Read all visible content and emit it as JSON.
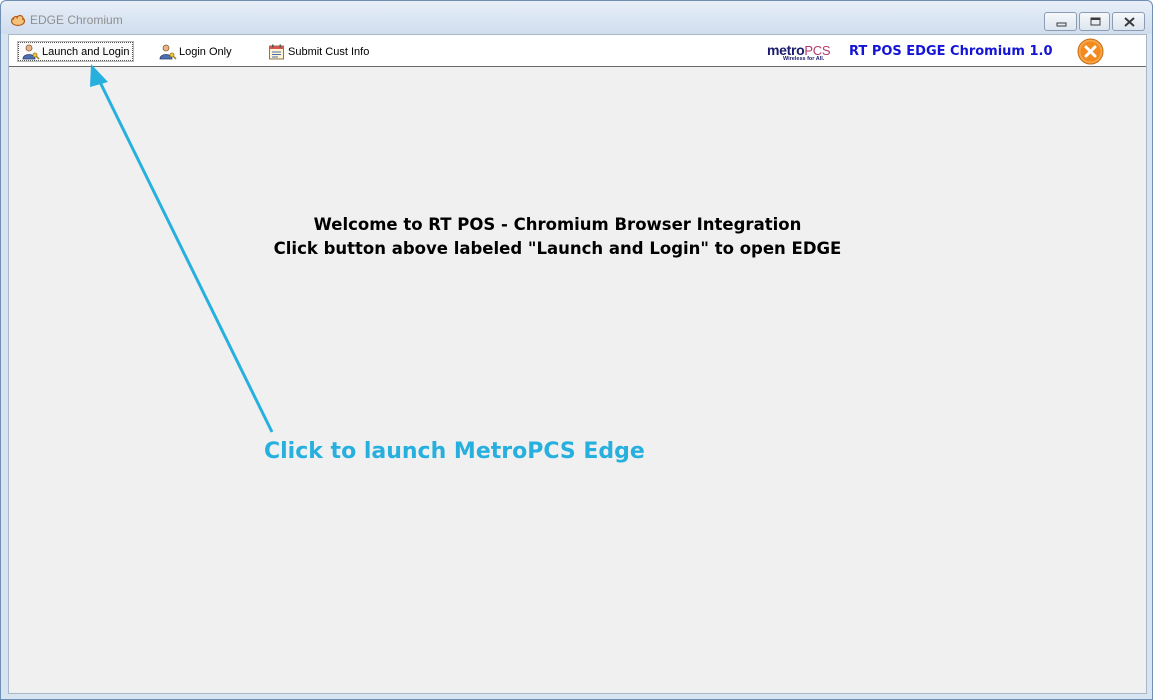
{
  "window": {
    "title": "EDGE Chromium",
    "icon": "cloud-app-icon",
    "controls": [
      "minimize-icon",
      "restore-icon",
      "close-icon"
    ]
  },
  "toolbar": {
    "buttons": [
      {
        "label": "Launch and Login",
        "icon": "user-key-icon",
        "focused": true
      },
      {
        "label": "Login Only",
        "icon": "user-key-icon"
      },
      {
        "label": "Submit Cust Info",
        "icon": "calendar-form-icon"
      }
    ],
    "logo": {
      "brand": "metroPCS",
      "tagline": "Wireless for All."
    },
    "app_version": "RT POS EDGE Chromium 1.0",
    "exit_icon": "orange-close-icon"
  },
  "main": {
    "welcome_line1": "Welcome to RT POS - Chromium Browser Integration",
    "welcome_line2": "Click button above labeled \"Launch and Login\" to open EDGE"
  },
  "annotation": {
    "text": "Click to launch MetroPCS Edge",
    "color": "#27b0de"
  },
  "colors": {
    "version_text": "#1414d6",
    "client_bg": "#f0f0f0",
    "exit_button": "#f28a1e"
  }
}
